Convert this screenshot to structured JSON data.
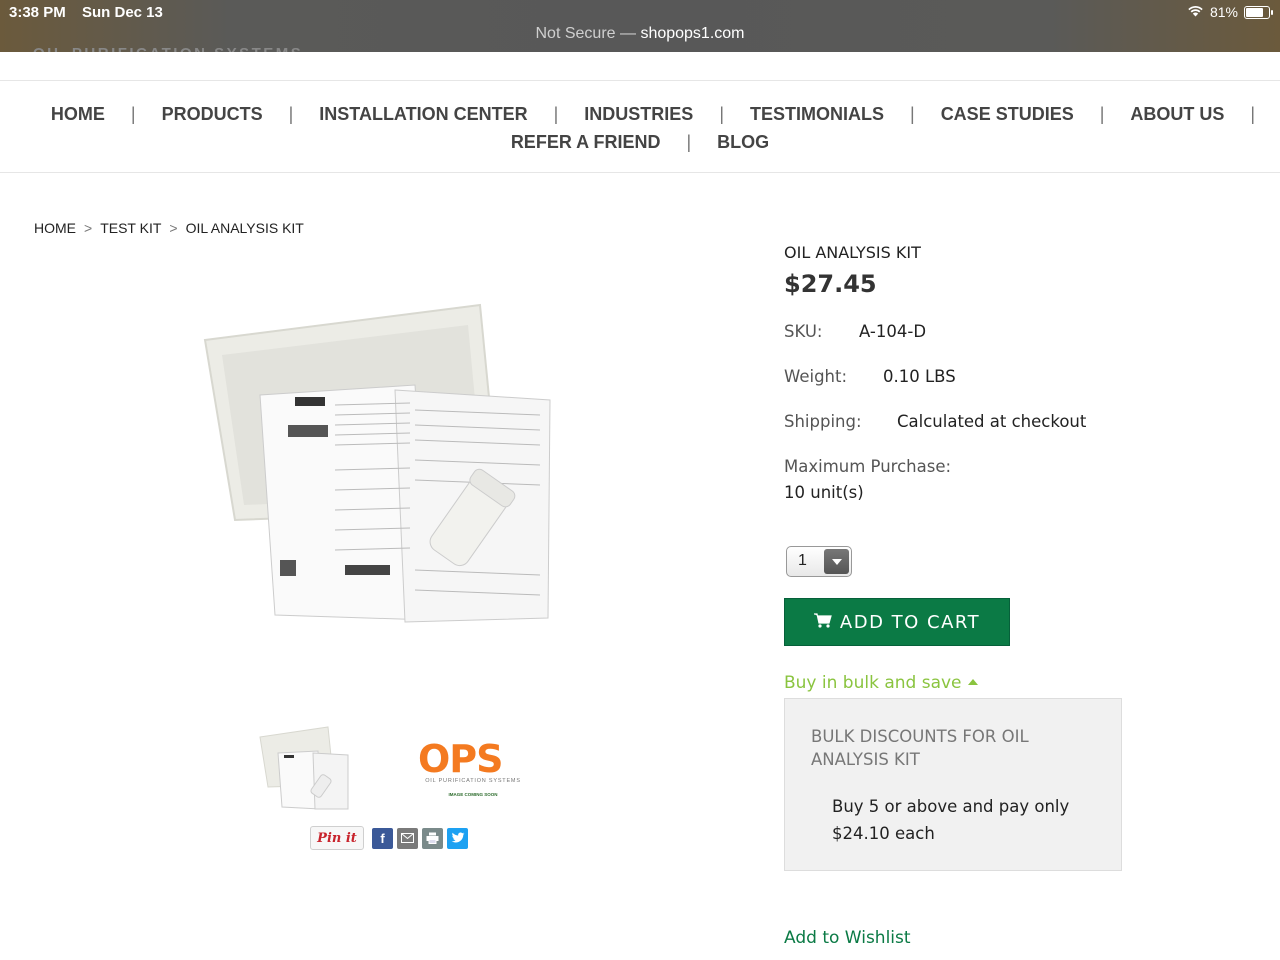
{
  "status_bar": {
    "time": "3:38 PM",
    "date": "Sun Dec 13",
    "url_prefix": "Not Secure —",
    "url_domain": "shopops1.com",
    "battery": "81%",
    "battery_level": 0.81
  },
  "header": {
    "logo_text": "OIL PURIFICATION SYSTEMS"
  },
  "nav": {
    "row1": [
      "HOME",
      "PRODUCTS",
      "INSTALLATION CENTER",
      "INDUSTRIES",
      "TESTIMONIALS",
      "CASE STUDIES",
      "ABOUT US"
    ],
    "row2": [
      "REFER A FRIEND",
      "BLOG"
    ]
  },
  "breadcrumb": [
    "HOME",
    "TEST KIT",
    "OIL ANALYSIS KIT"
  ],
  "product": {
    "title": "OIL ANALYSIS KIT",
    "price": "$27.45",
    "sku_label": "SKU:",
    "sku": "A-104-D",
    "weight_label": "Weight:",
    "weight": "0.10 LBS",
    "shipping_label": "Shipping:",
    "shipping": "Calculated at checkout",
    "max_label": "Maximum Purchase:",
    "max_value": "10 unit(s)",
    "quantity": "1",
    "add_to_cart": "ADD TO CART",
    "bulk_toggle": "Buy in bulk and save",
    "bulk_title": "BULK DISCOUNTS FOR OIL ANALYSIS KIT",
    "bulk_text": "Buy 5 or above and pay only $24.10 each",
    "wishlist": "Add to Wishlist"
  },
  "thumbnail_logo": {
    "brand": "OPS",
    "subtitle": "OIL PURIFICATION SYSTEMS",
    "note": "IMAGE COMING SOON"
  },
  "share": {
    "pinterest": "Pin it",
    "icons": [
      "facebook-icon",
      "email-icon",
      "print-icon",
      "twitter-icon"
    ]
  },
  "colors": {
    "accent_green": "#0b7a45",
    "bulk_link": "#8ac43f",
    "ops_orange": "#f47a20"
  }
}
